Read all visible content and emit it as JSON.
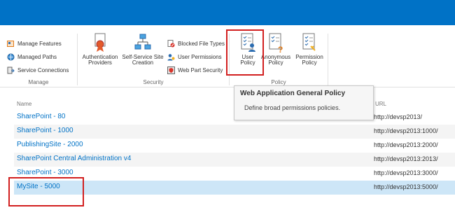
{
  "ribbon": {
    "manage": {
      "label": "Manage",
      "items": [
        "Manage Features",
        "Managed Paths",
        "Service Connections"
      ]
    },
    "security": {
      "label": "Security",
      "large": [
        {
          "label": "Authentication Providers",
          "line1": "Authentication",
          "line2": "Providers"
        },
        {
          "label": "Self-Service Site Creation",
          "line1": "Self-Service Site",
          "line2": "Creation"
        }
      ],
      "small": [
        "Blocked File Types",
        "User Permissions",
        "Web Part Security"
      ]
    },
    "policy": {
      "label": "Policy",
      "buttons": [
        {
          "line1": "User",
          "line2": "Policy"
        },
        {
          "line1": "Anonymous",
          "line2": "Policy"
        },
        {
          "line1": "Permission",
          "line2": "Policy"
        }
      ]
    }
  },
  "tooltip": {
    "title": "Web Application General Policy",
    "description": "Define broad permissions policies."
  },
  "table": {
    "columns": {
      "name": "Name",
      "url": "URL"
    },
    "rows": [
      {
        "name": "SharePoint - 80",
        "url": "http://devsp2013/"
      },
      {
        "name": "SharePoint - 1000",
        "url": "http://devsp2013:1000/"
      },
      {
        "name": "PublishingSite - 2000",
        "url": "http://devsp2013:2000/"
      },
      {
        "name": "SharePoint Central Administration v4",
        "url": "http://devsp2013:2013/"
      },
      {
        "name": "SharePoint - 3000",
        "url": "http://devsp2013:3000/"
      },
      {
        "name": "MySite - 5000",
        "url": "http://devsp2013:5000/"
      }
    ],
    "selected_row": "MySite - 5000"
  },
  "colors": {
    "suite_bar": "#0072c6",
    "link": "#0072c6",
    "selected_row": "#cde6f7",
    "highlight": "#d21f1f"
  }
}
